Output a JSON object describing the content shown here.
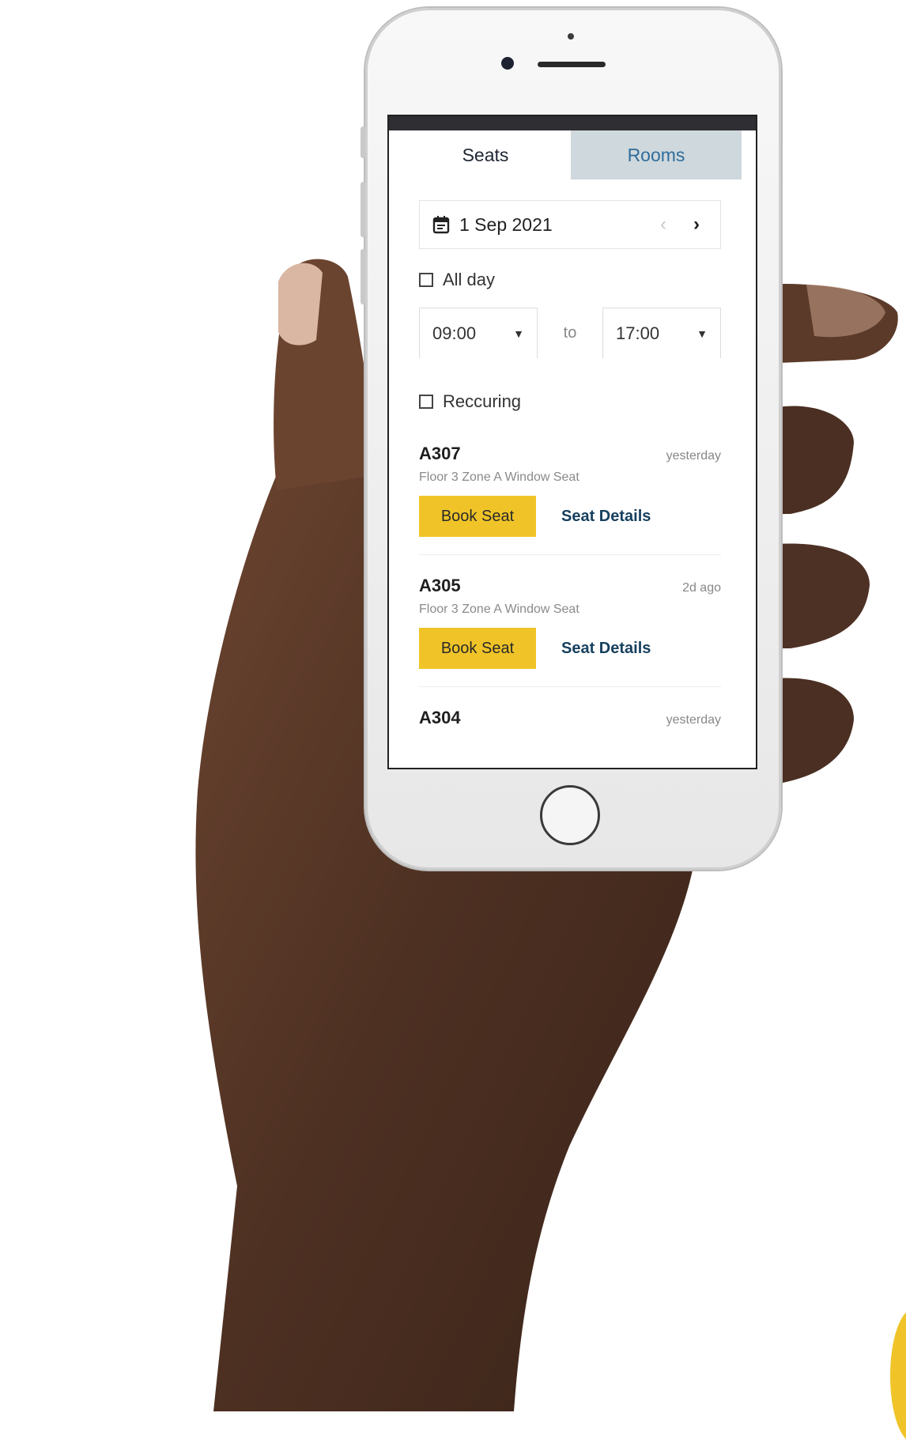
{
  "tabs": [
    {
      "label": "Seats",
      "active": true
    },
    {
      "label": "Rooms",
      "active": false
    }
  ],
  "date_picker": {
    "date": "1 Sep 2021",
    "prev_icon": "chevron-left-icon",
    "next_icon": "chevron-right-icon",
    "calendar_icon": "calendar-icon"
  },
  "all_day": {
    "label": "All day",
    "checked": false
  },
  "time_range": {
    "start": "09:00",
    "separator": "to",
    "end": "17:00"
  },
  "recurring": {
    "label": "Reccuring",
    "checked": false
  },
  "seats": [
    {
      "id": "A307",
      "time": "yesterday",
      "meta": "Floor 3  Zone A  Window Seat",
      "book_label": "Book Seat",
      "details_label": "Seat Details"
    },
    {
      "id": "A305",
      "time": "2d ago",
      "meta": "Floor 3  Zone A  Window Seat",
      "book_label": "Book Seat",
      "details_label": "Seat Details"
    },
    {
      "id": "A304",
      "time": "yesterday"
    }
  ],
  "colors": {
    "accent": "#f0c428",
    "tab_inactive_bg": "#cfd8dc",
    "link": "#17405e",
    "skin": "#5a3a28"
  }
}
